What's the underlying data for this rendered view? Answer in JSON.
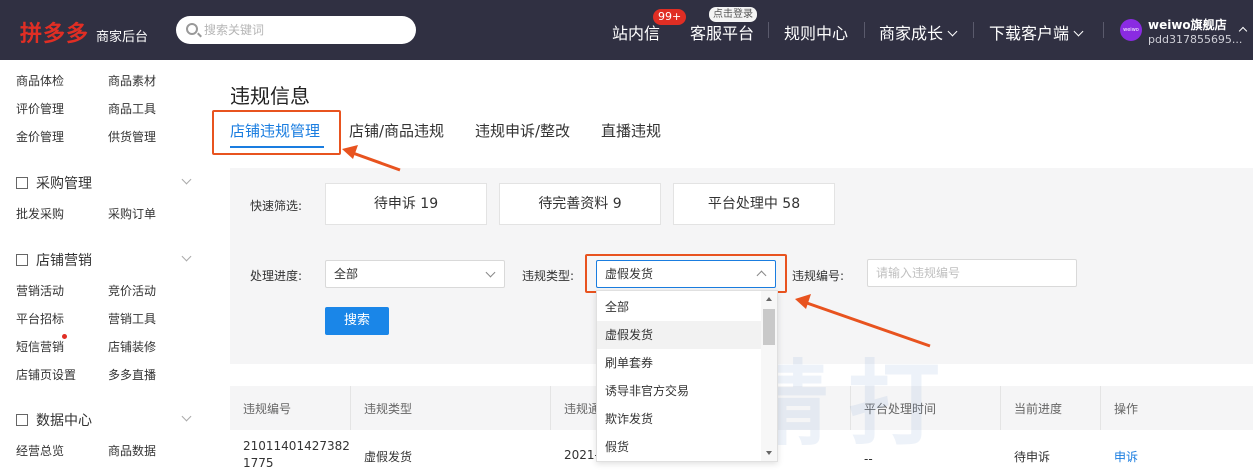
{
  "header": {
    "logo": "拼多多",
    "logo_sub": "商家后台",
    "search_placeholder": "搜索关键词",
    "nav": {
      "messages": "站内信",
      "messages_badge": "99+",
      "service": "客服平台",
      "service_badge": "点击登录",
      "rules": "规则中心",
      "growth": "商家成长",
      "download": "下载客户端"
    },
    "avatar_text": "weiwo",
    "shop_name": "weiwo旗舰店",
    "shop_id": "pdd317855695..."
  },
  "sidebar": {
    "top_links": [
      "商品体检",
      "商品素材",
      "评价管理",
      "商品工具",
      "金价管理",
      "供货管理"
    ],
    "purchase": {
      "title": "采购管理",
      "links": [
        "批发采购",
        "采购订单"
      ]
    },
    "marketing": {
      "title": "店铺营销",
      "links": [
        "营销活动",
        "竞价活动",
        "平台招标",
        "营销工具",
        "短信营销",
        "店铺装修",
        "店铺页设置",
        "多多直播"
      ]
    },
    "data": {
      "title": "数据中心",
      "links": [
        "经营总览",
        "商品数据"
      ]
    }
  },
  "main": {
    "title": "违规信息",
    "tabs": [
      "店铺违规管理",
      "店铺/商品违规",
      "违规申诉/整改",
      "直播违规"
    ],
    "quick_filter_label": "快速筛选:",
    "quick_filters": [
      "待申诉  19",
      "待完善资料  9",
      "平台处理中  58"
    ],
    "progress_label": "处理进度:",
    "progress_value": "全部",
    "type_label": "违规类型:",
    "type_value": "虚假发货",
    "number_label": "违规编号:",
    "number_placeholder": "请输入违规编号",
    "search_button": "搜索",
    "dropdown_options": [
      "全部",
      "虚假发货",
      "刷单套券",
      "诱导非官方交易",
      "欺诈发货",
      "假货"
    ],
    "table": {
      "headers": [
        "违规编号",
        "违规类型",
        "违规通",
        "平台处理时间",
        "当前进度",
        "操作"
      ],
      "row": {
        "id_line1": "21011401427382",
        "id_line2": "1775",
        "type": "虚假发货",
        "date": "2021-0",
        "platform_time": "--",
        "progress": "待申诉",
        "action": "申诉"
      }
    },
    "watermark": "精打"
  },
  "colors": {
    "topbar": "#303042",
    "brand_red": "#e02e24",
    "accent_blue": "#1a7de0",
    "highlight": "#e8531f"
  }
}
